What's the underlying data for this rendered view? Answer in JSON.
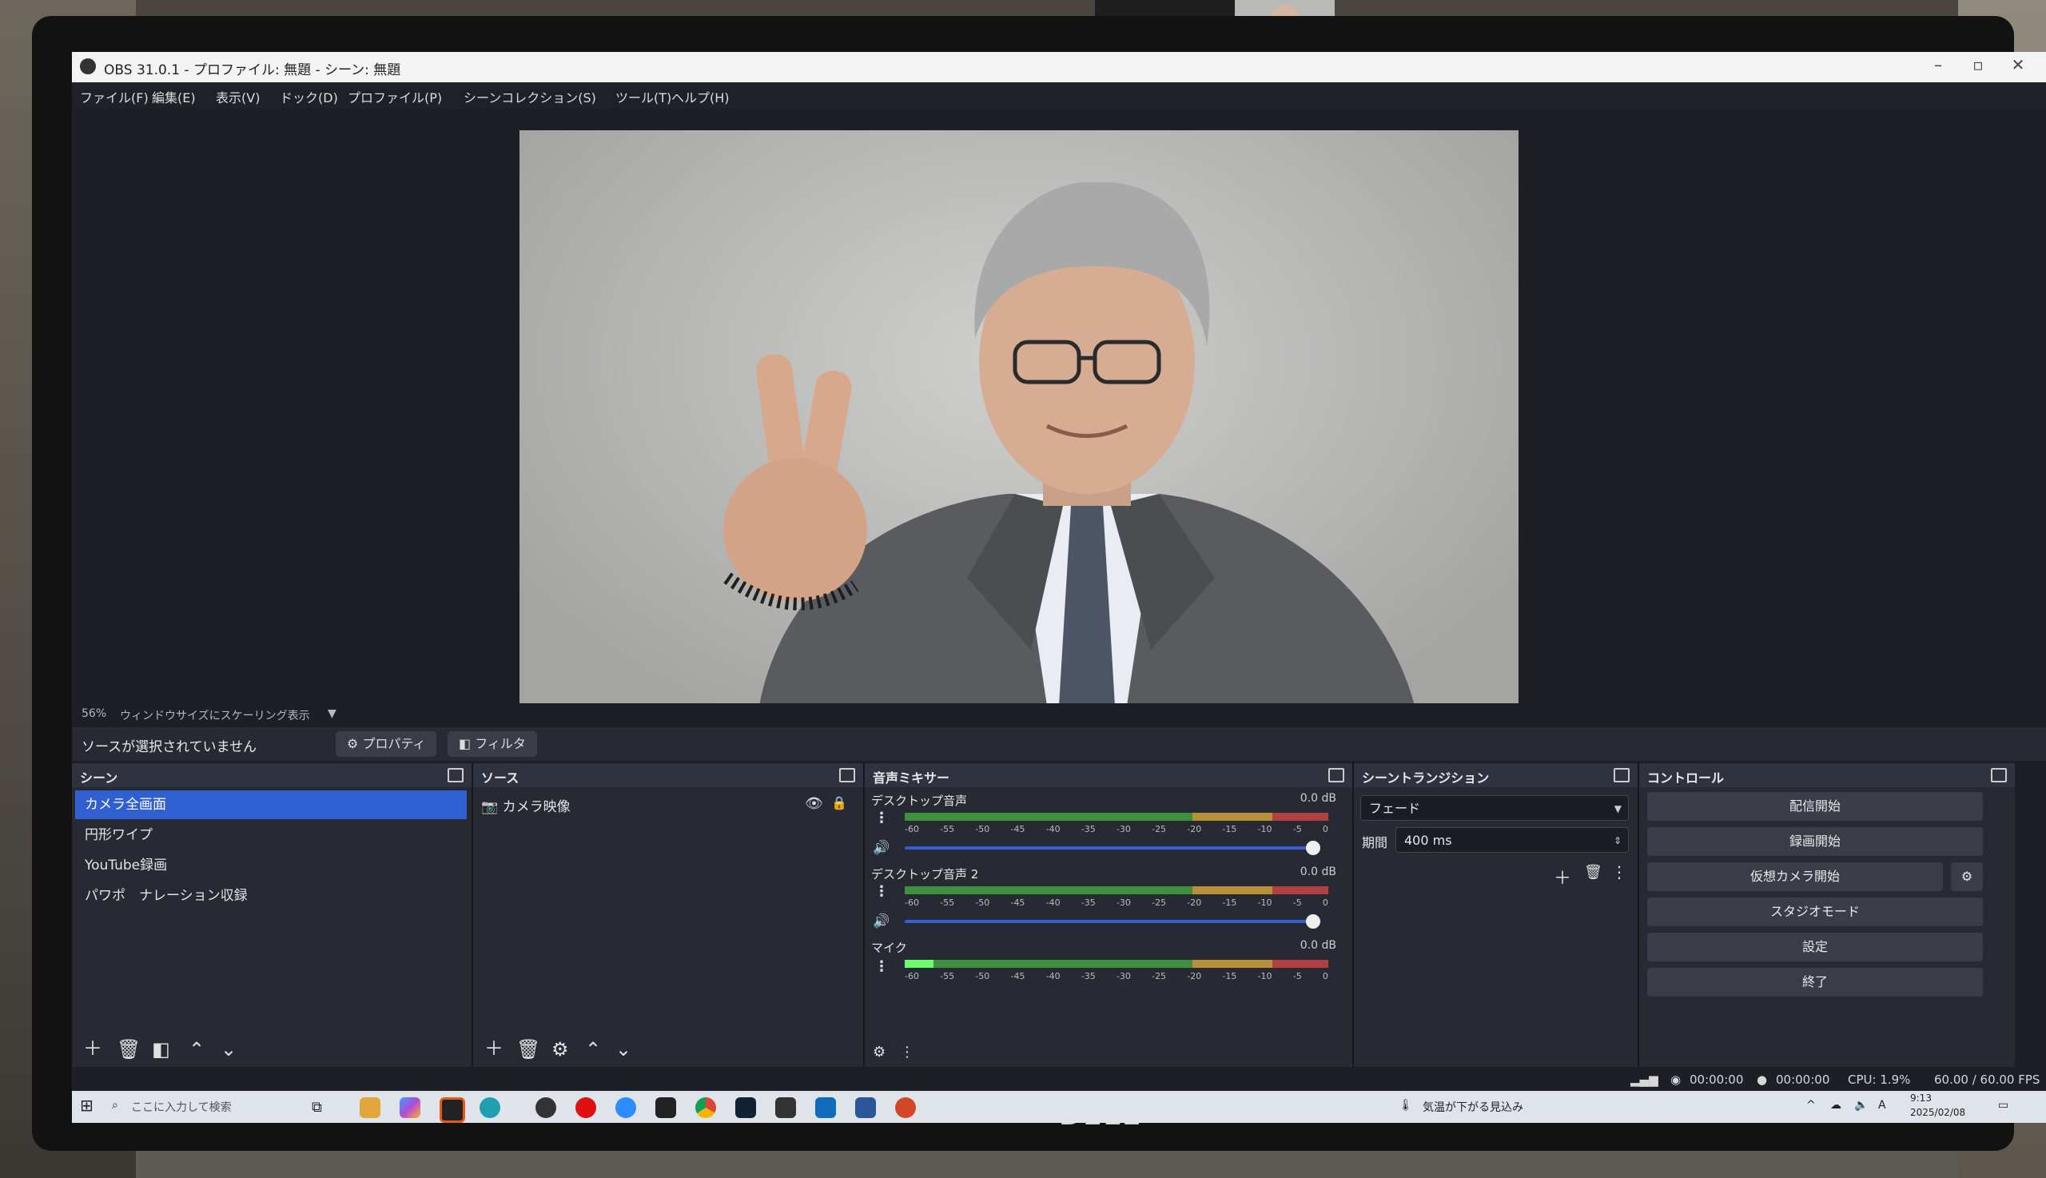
{
  "window": {
    "title": "OBS 31.0.1 - プロファイル: 無題 - シーン: 無題",
    "minimize": "–",
    "maximize": "▫",
    "close": "✕"
  },
  "menu": [
    "ファイル(F)",
    "編集(E)",
    "表示(V)",
    "ドック(D)",
    "プロファイル(P)",
    "シーンコレクション(S)",
    "ツール(T)",
    "ヘルプ(H)"
  ],
  "preview": {
    "zoom": "56%",
    "scaling_mode": "ウィンドウサイズにスケーリング表示"
  },
  "source_toolbar": {
    "no_selection": "ソースが選択されていません",
    "properties": "プロパティ",
    "filters": "フィルタ"
  },
  "scenes": {
    "title": "シーン",
    "items": [
      "カメラ全画面",
      "円形ワイプ",
      "YouTube録画",
      "パワポ　ナレーション収録"
    ],
    "selected_index": 0
  },
  "sources": {
    "title": "ソース",
    "items": [
      "カメラ映像"
    ]
  },
  "mixer": {
    "title": "音声ミキサー",
    "channels": [
      {
        "name": "デスクトップ音声",
        "db": "0.0 dB",
        "volume_fraction": 0.97
      },
      {
        "name": "デスクトップ音声 2",
        "db": "0.0 dB",
        "volume_fraction": 0.97
      },
      {
        "name": "マイク",
        "db": "0.0 dB",
        "volume_fraction": 0.97
      }
    ],
    "ticks": [
      "-60",
      "-55",
      "-50",
      "-45",
      "-40",
      "-35",
      "-30",
      "-25",
      "-20",
      "-15",
      "-10",
      "-5",
      "0"
    ]
  },
  "transitions": {
    "title": "シーントランジション",
    "type": "フェード",
    "duration_label": "期間",
    "duration": "400 ms"
  },
  "controls": {
    "title": "コントロール",
    "buttons": [
      "配信開始",
      "録画開始",
      "仮想カメラ開始",
      "スタジオモード",
      "設定",
      "終了"
    ]
  },
  "status": {
    "stream_time": "00:00:00",
    "rec_time": "00:00:00",
    "cpu": "CPU: 1.9%",
    "fps": "60.00 / 60.00 FPS"
  },
  "taskbar": {
    "search_placeholder": "ここに入力して検索",
    "weather": "気温が下がる見込み",
    "ime": "A",
    "time": "9:13",
    "date": "2025/02/08"
  },
  "monitor_brand": "DELL",
  "colors": {
    "accent": "#2f5fd0",
    "meter_green": "#3e8f3e",
    "meter_yellow": "#b8913a",
    "meter_red": "#b34040"
  }
}
